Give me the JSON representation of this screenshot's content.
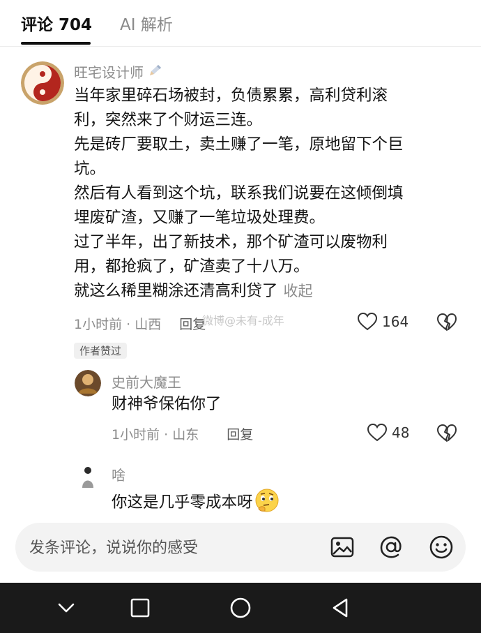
{
  "tabs": {
    "comments_label": "评论 704",
    "ai_label": "AI 解析"
  },
  "comments": [
    {
      "username": "旺宅设计师",
      "username_icon": "pencil-icon",
      "lines": [
        "当年家里碎石场被封，负债累累，高利贷利滚",
        "利，突然来了个财运三连。",
        "先是砖厂要取土，卖土赚了一笔，原地留下个巨",
        "坑。",
        "然后有人看到这个坑，联系我们说要在这倾倒填",
        "埋废矿渣，又赚了一笔垃圾处理费。",
        "过了半年，出了新技术，那个矿渣可以废物利",
        "用，都抢疯了，矿渣卖了十八万。",
        "就这么稀里糊涂还清高利贷了"
      ],
      "collapse_label": "收起",
      "time": "1小时前 · 山西",
      "reply_label": "回复",
      "likes": "164",
      "author_badge": "作者赞过"
    },
    {
      "username": "史前大魔王",
      "text": "财神爷保佑你了",
      "time": "1小时前 · 山东",
      "reply_label": "回复",
      "likes": "48"
    },
    {
      "username": "啥",
      "text": "你这是几乎零成本呀",
      "emoji": "thinking-face-emoji"
    }
  ],
  "watermark": "微博@未有-成年",
  "input": {
    "placeholder": "发条评论，说说你的感受"
  },
  "colors": {
    "text_primary": "#141414",
    "text_secondary": "#8c8c8c",
    "input_bg": "#f3f3f3",
    "navbar_bg": "#1a1a1a"
  }
}
